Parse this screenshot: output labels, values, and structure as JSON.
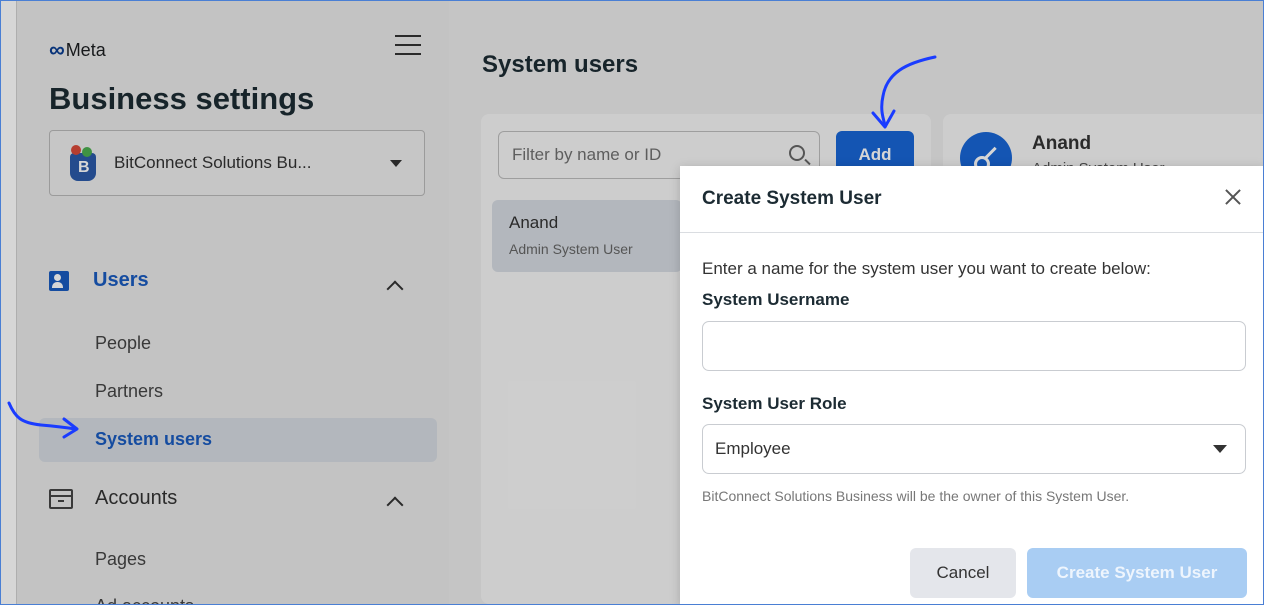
{
  "sidebar": {
    "brand": "Meta",
    "title": "Business settings",
    "business_name": "BitConnect Solutions Bu...",
    "sections": {
      "users": "Users",
      "accounts": "Accounts"
    },
    "items": {
      "people": "People",
      "partners": "Partners",
      "system_users": "System users",
      "pages": "Pages",
      "ad_accounts": "Ad accounts"
    }
  },
  "main": {
    "title": "System users",
    "filter_placeholder": "Filter by name or ID",
    "add_label": "Add",
    "list": [
      {
        "name": "Anand",
        "role": "Admin System User"
      }
    ],
    "detail": {
      "name": "Anand",
      "role": "Admin System User"
    }
  },
  "modal": {
    "title": "Create System User",
    "instruction": "Enter a name for the system user you want to create below:",
    "username_label": "System Username",
    "username_value": "",
    "role_label": "System User Role",
    "role_value": "Employee",
    "owner_note": "BitConnect Solutions Business will be the owner of this System User.",
    "cancel_label": "Cancel",
    "create_label": "Create System User"
  },
  "colors": {
    "accent": "#1866d6",
    "annotation": "#1a3cff",
    "create_disabled": "#a9cdf3"
  }
}
